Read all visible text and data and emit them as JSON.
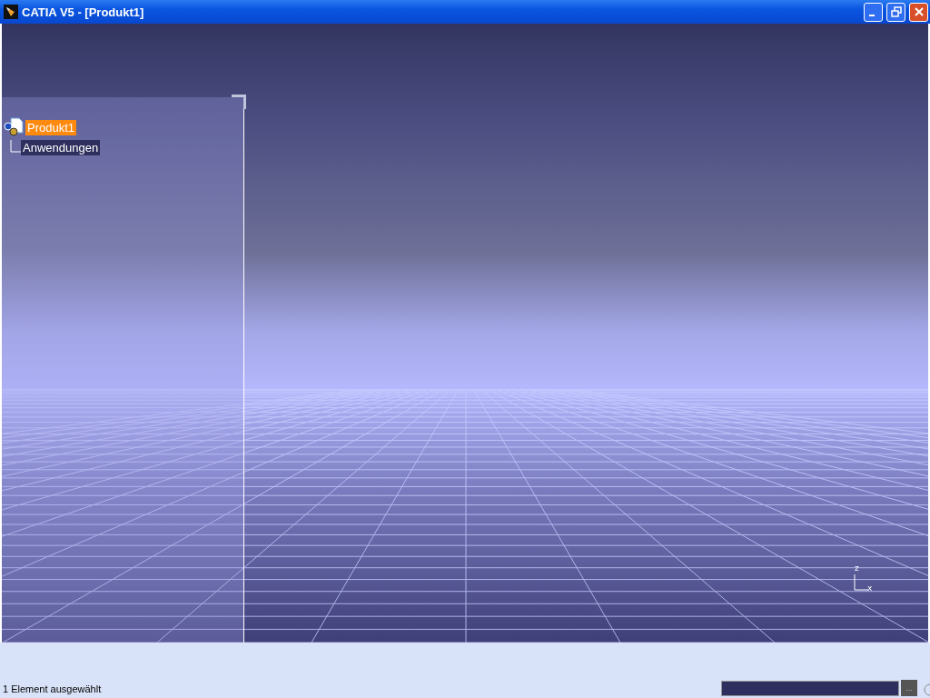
{
  "window": {
    "title": "CATIA V5 - [Produkt1]"
  },
  "tree": [
    {
      "label": "Produkt1",
      "selected": true,
      "children": [
        {
          "label": "Anwendungen",
          "selected": false
        }
      ]
    }
  ],
  "axis": {
    "z_label": "z",
    "x_label": "x"
  },
  "status_bar": {
    "message": "1 Element ausgewählt",
    "command_button": "..."
  }
}
